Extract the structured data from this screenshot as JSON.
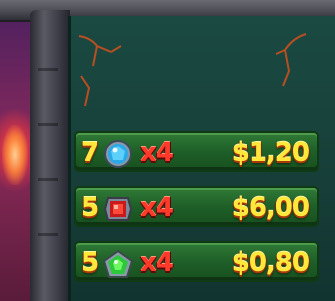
{
  "wins": [
    {
      "count": "7",
      "gem": "blue-gem-icon",
      "multiplier": "x4",
      "amount": "$1,20"
    },
    {
      "count": "5",
      "gem": "red-gem-icon",
      "multiplier": "x4",
      "amount": "$6,00"
    },
    {
      "count": "5",
      "gem": "green-gem-icon",
      "multiplier": "x4",
      "amount": "$0,80"
    }
  ],
  "colors": {
    "value_text": "#ffe83a",
    "multiplier_text": "#ff3a2a",
    "row_bg": "#2f7a36",
    "reel_bg": "#1a4a42"
  }
}
